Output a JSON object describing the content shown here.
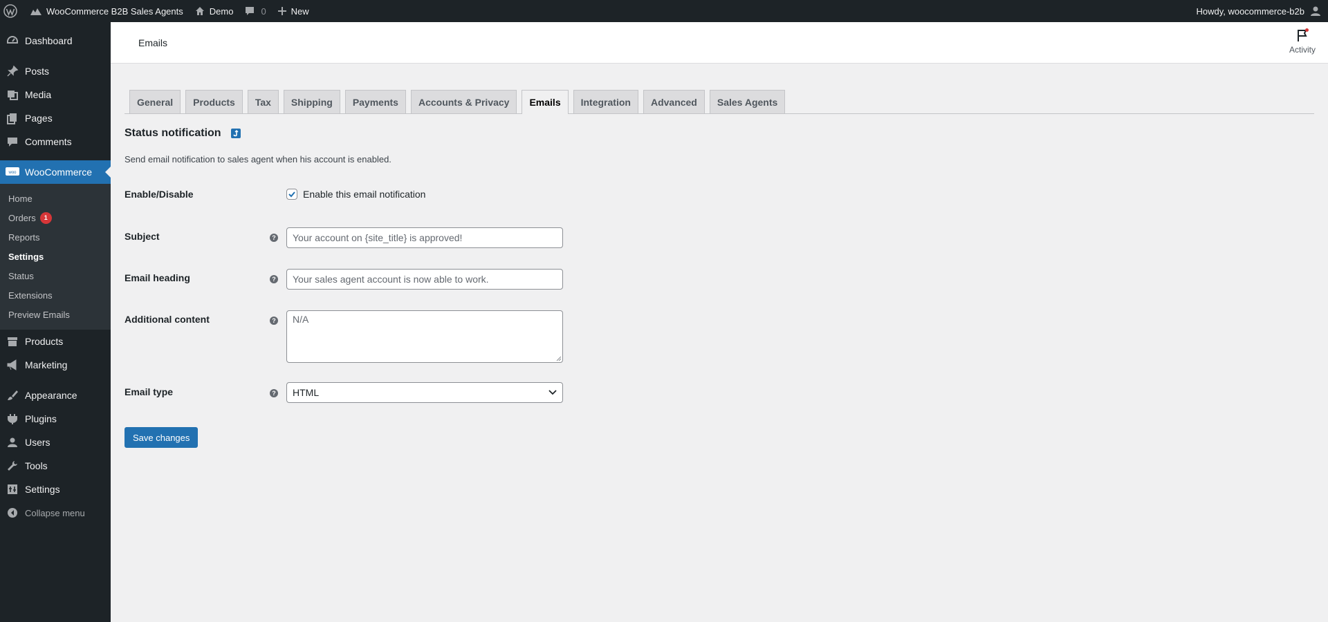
{
  "adminbar": {
    "site_name": "WooCommerce B2B Sales Agents",
    "demo": "Demo",
    "comments_count": "0",
    "new": "New",
    "howdy": "Howdy, woocommerce-b2b"
  },
  "sidebar": {
    "items_top": [
      {
        "label": "Dashboard",
        "icon": "dashboard-icon"
      },
      {
        "label": "Posts",
        "icon": "pin-icon"
      },
      {
        "label": "Media",
        "icon": "media-icon"
      },
      {
        "label": "Pages",
        "icon": "pages-icon"
      },
      {
        "label": "Comments",
        "icon": "comment-icon"
      }
    ],
    "woocommerce": {
      "label": "WooCommerce",
      "icon_text": "woo"
    },
    "submenu": [
      {
        "label": "Home"
      },
      {
        "label": "Orders",
        "badge": "1"
      },
      {
        "label": "Reports"
      },
      {
        "label": "Settings"
      },
      {
        "label": "Status"
      },
      {
        "label": "Extensions"
      },
      {
        "label": "Preview Emails"
      }
    ],
    "items_bottom": [
      {
        "label": "Products"
      },
      {
        "label": "Marketing"
      },
      {
        "label": "Appearance"
      },
      {
        "label": "Plugins"
      },
      {
        "label": "Users"
      },
      {
        "label": "Tools"
      },
      {
        "label": "Settings"
      }
    ],
    "collapse": "Collapse menu"
  },
  "header": {
    "title": "Emails",
    "activity": "Activity"
  },
  "tabs": [
    {
      "label": "General"
    },
    {
      "label": "Products"
    },
    {
      "label": "Tax"
    },
    {
      "label": "Shipping"
    },
    {
      "label": "Payments"
    },
    {
      "label": "Accounts & Privacy"
    },
    {
      "label": "Emails",
      "active": true
    },
    {
      "label": "Integration"
    },
    {
      "label": "Advanced"
    },
    {
      "label": "Sales Agents"
    }
  ],
  "section": {
    "title": "Status notification",
    "description": "Send email notification to sales agent when his account is enabled."
  },
  "form": {
    "enable_label": "Enable/Disable",
    "enable_checkbox_label": "Enable this email notification",
    "enable_checked": true,
    "subject_label": "Subject",
    "subject_placeholder": "Your account on {site_title} is approved!",
    "heading_label": "Email heading",
    "heading_placeholder": "Your sales agent account is now able to work.",
    "additional_label": "Additional content",
    "additional_placeholder": "N/A",
    "email_type_label": "Email type",
    "email_type_value": "HTML",
    "help_glyph": "?"
  },
  "save_button": "Save changes",
  "colors": {
    "accent": "#2271b1",
    "adminbar": "#1d2327",
    "badge": "#d63638"
  }
}
